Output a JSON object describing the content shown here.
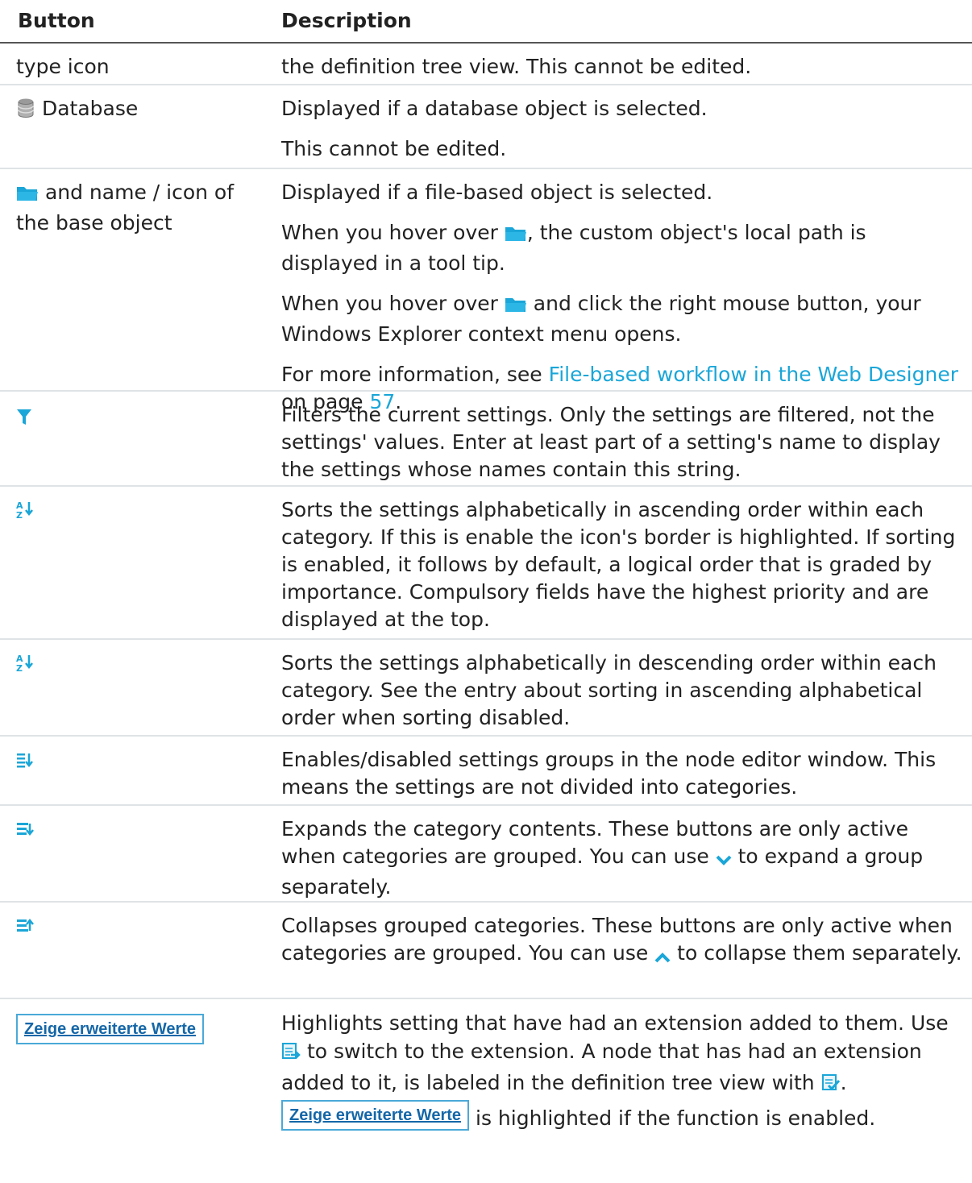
{
  "table": {
    "headers": {
      "col1": "Button",
      "col2": "Description"
    },
    "rows": [
      {
        "c1": "type icon",
        "p": [
          "the definition tree view. This cannot be edited."
        ]
      },
      {
        "c1": "Database",
        "p": [
          "Displayed if a database object is selected.",
          "This cannot be edited."
        ]
      },
      {
        "c1": "and name / icon of the base object",
        "p1": "Displayed if a file-based object is selected.",
        "p2a": "When you hover over ",
        "p2b": ", the custom object's local path is displayed in a tool tip.",
        "p3a": "When you hover over ",
        "p3b": " and click the right mouse button, your Windows Explorer context menu opens.",
        "p4a": "For more information, see ",
        "p4link": "File-based workflow in the Web Designer",
        "p4b": " on page ",
        "p4page": "57",
        "p4c": "."
      },
      {
        "icon": "filter-icon",
        "p": [
          "Filters the current settings. Only the settings are filtered, not the settings' values. Enter at least part of a setting's name to display the settings whose names contain this string."
        ]
      },
      {
        "icon": "sort-ascending-icon",
        "p": [
          "Sorts the settings alphabetically in ascending order within each category. If this is enable the icon's border is highlighted. If sorting is enabled, it follows by default, a logical order that is graded by importance. Compulsory fields have the highest priority and are displayed at the top."
        ]
      },
      {
        "icon": "sort-descending-icon",
        "p": [
          "Sorts the settings alphabetically in descending order within each category. See the entry about sorting in ascending alphabetical order when sorting disabled."
        ]
      },
      {
        "icon": "group-icon",
        "p": [
          "Enables/disabled settings groups in the node editor window. This means the settings are not divided into categories."
        ]
      },
      {
        "icon": "expand-all-icon",
        "p1a": "Expands the category contents. These buttons are only active when categories are grouped. You can use ",
        "p1b": " to expand a group separately."
      },
      {
        "icon": "collapse-all-icon",
        "p1a": "Collapses grouped categories. These buttons are only active when categories are grouped. You can use ",
        "p1b": " to collapse them separately."
      },
      {
        "button": "Zeige erweiterte Werte",
        "p1a": "Highlights setting that have had an extension added to them. Use ",
        "p1b": " to switch to the extension. A node that has had an extension added to it, is labeled in the definition tree view with ",
        "p1c": ". ",
        "p1d": " is highlighted if the function is enabled."
      }
    ]
  },
  "colors": {
    "link": "#1aa6d8",
    "icon": "#1aa6d8",
    "border": "#dfe3e6"
  }
}
